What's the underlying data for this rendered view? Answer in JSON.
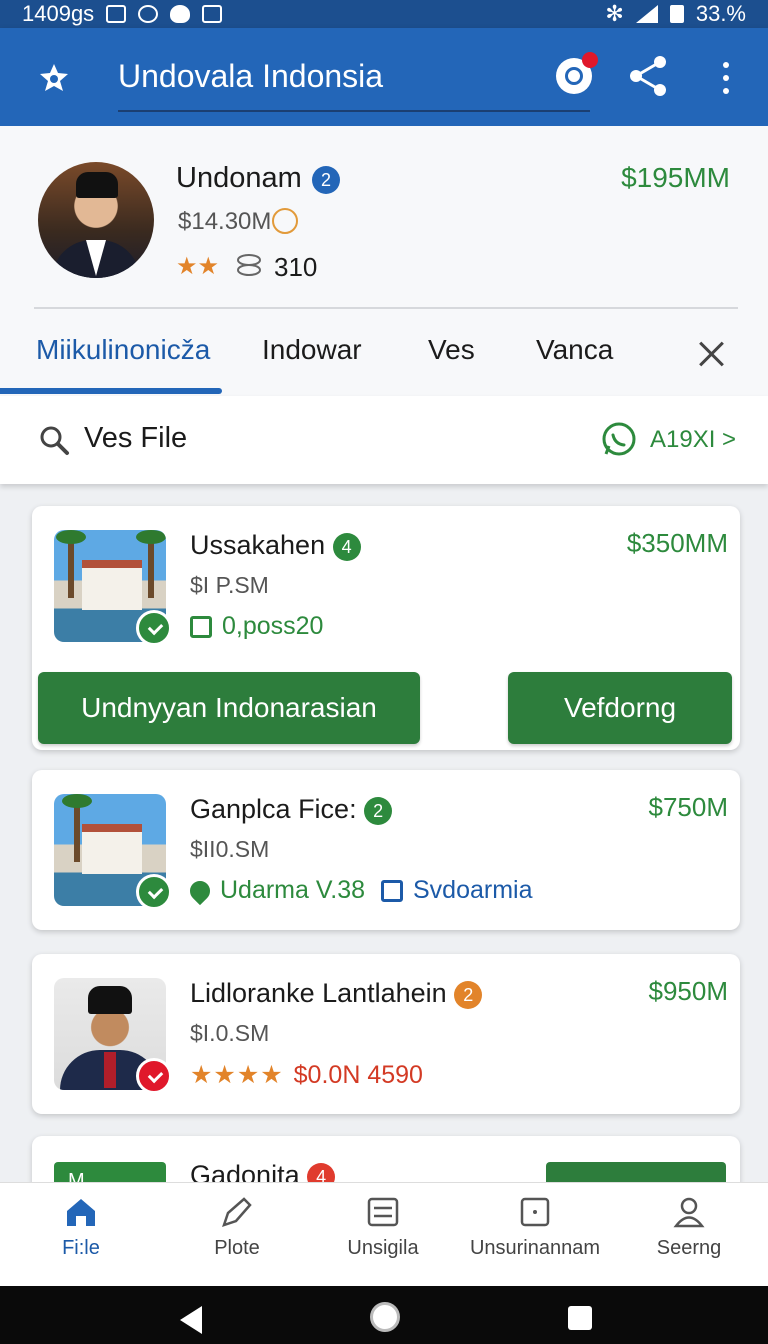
{
  "status_bar": {
    "time": "1409gs",
    "battery": "33.%"
  },
  "app_bar": {
    "title": "Undovala Indonsia"
  },
  "profile": {
    "name": "Undonam",
    "badge": "2",
    "subtitle": "$14.30M",
    "stars": "★★",
    "count": "310",
    "price": "$195MM"
  },
  "tabs": [
    "Miikulinonicža",
    "Indowar",
    "Ves",
    "Vanca"
  ],
  "search": {
    "label": "Ves File",
    "link": "A19XI >"
  },
  "cards": [
    {
      "title": "Ussakahen",
      "badge": "4",
      "subtitle": "$I P.SM",
      "price": "$350MM",
      "meta": "0,poss20",
      "button_primary": "Undnyyan Indonarasian",
      "button_secondary": "Vefdorng"
    },
    {
      "title": "Ganplca Fice:",
      "badge": "2",
      "subtitle": "$II0.SM",
      "price": "$750M",
      "meta": "Udarma V.38",
      "meta2": "Svdoarmia"
    },
    {
      "title": "Lidloranke Lantlahein",
      "badge": "2",
      "subtitle": "$I.0.SM",
      "price": "$950M",
      "stars": "★★★★",
      "meta": "$0.0N 4590"
    },
    {
      "title": "Gadonita",
      "badge": "4",
      "thumb_label": "M...."
    }
  ],
  "bottom_nav": [
    "Fi:le",
    "Plote",
    "Unsigila",
    "Unsurinannam",
    "Seerng"
  ],
  "colors": {
    "primary": "#2366b8",
    "accent_green": "#2d8a3d"
  }
}
